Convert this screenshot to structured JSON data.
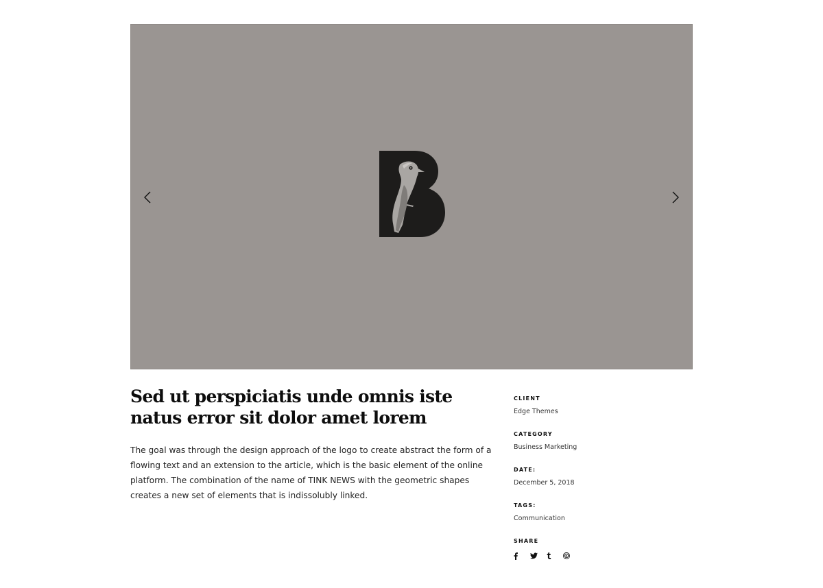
{
  "slider": {
    "background": "#9a9592",
    "logo_icon": "bird-letter-b-logo",
    "prev_icon": "chevron-left-icon",
    "next_icon": "chevron-right-icon"
  },
  "project": {
    "title": "Sed ut perspiciatis unde omnis iste natus error sit dolor amet lorem",
    "description": "The goal was through the design approach of the logo to create abstract the form of a flowing text and an extension to the article, which is the basic element of the online platform. The combination of the name of TINK NEWS with the geometric shapes creates a new set of elements that is indissolubly linked."
  },
  "meta": {
    "client": {
      "label": "CLIENT",
      "value": "Edge Themes"
    },
    "category": {
      "label": "CATEGORY",
      "value": "Business Marketing"
    },
    "date": {
      "label": "DATE:",
      "value": "December 5, 2018"
    },
    "tags": {
      "label": "TAGS:",
      "value": "Communication"
    },
    "share": {
      "label": "SHARE",
      "icons": [
        "facebook-icon",
        "twitter-icon",
        "tumblr-icon",
        "pinterest-icon"
      ]
    }
  }
}
